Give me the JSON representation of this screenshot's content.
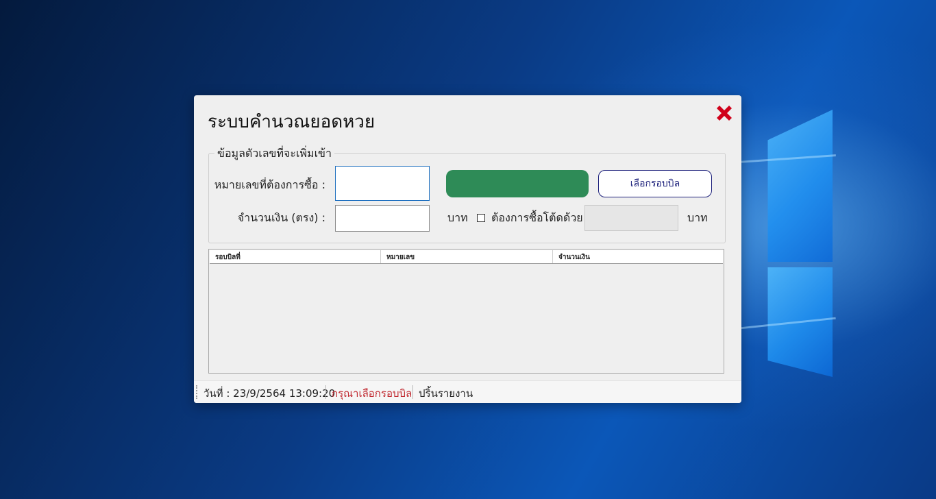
{
  "app": {
    "title": "ระบบคำนวณยอดหวย"
  },
  "form": {
    "group_title": "ข้อมูลตัวเลขที่จะเพิ่มเข้า",
    "number_label": "หมายเลขที่ต้องการซื้อ :",
    "number_value": "",
    "amount_label": "จำนวนเงิน (ตรง) :",
    "amount_value": "",
    "amount_unit": "บาท",
    "toad_checkbox_label": "ต้องการซื้อโต้ดด้วย",
    "toad_checked": false,
    "toad_amount_value": "",
    "toad_unit": "บาท",
    "select_round_button": "เลือกรอบบิล",
    "green_button_label": ""
  },
  "grid": {
    "columns": [
      "รอบบิลที่",
      "หมายเลข",
      "จำนวนเงิน"
    ],
    "rows": []
  },
  "statusbar": {
    "datetime": "วันที่ : 23/9/2564 13:09:20",
    "message": "กรุณาเลือกรอบบิล",
    "print_report": "ปริ้นรายงาน"
  },
  "colors": {
    "green_button": "#2e8b57",
    "status_message": "#c0282f",
    "close_icon": "#d0021b",
    "outline_button": "#1b1f7a"
  },
  "icons": {
    "close": "close-x-icon"
  }
}
